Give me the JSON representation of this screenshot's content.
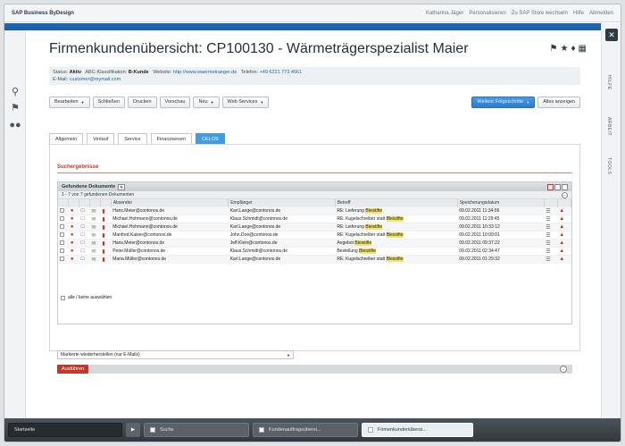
{
  "app": {
    "name": "SAP Business ByDesign",
    "topnav": [
      "Katharina Jäger",
      "Personalisieren",
      "Zu SAP Store wechseln",
      "Hilfe",
      "Abmelden"
    ]
  },
  "page": {
    "title": "Firmenkundenübersicht: CP100130 - Wärmeträgerspezialist Maier",
    "info": {
      "status_label": "Status:",
      "status_value": "Aktiv",
      "abc_label": "ABC-Klassifikation:",
      "abc_value": "B-Kunde",
      "web_label": "Website:",
      "web_value": "http://www.waermetraeger.de",
      "phone_label": "Telefon:",
      "phone_value": "+49 6221 773 4561",
      "email_label": "E-Mail:",
      "email_value": "customer@mymail.com"
    }
  },
  "toolbar": {
    "bearbeiten": "Bearbeiten",
    "schliessen": "Schließen",
    "drucken": "Drucken",
    "vorschau": "Vorschau",
    "neu": "Neu",
    "web_services": "Web Services",
    "weitere": "Weitere Folgeschritte",
    "alles_anzeigen": "Alles anzeigen"
  },
  "tabs": [
    "Allgemein",
    "Verlauf",
    "Service",
    "Finanzwesen",
    "CELOS"
  ],
  "results": {
    "section_title": "Suchergebnisse",
    "box_title": "Gefundene Dokumente",
    "count": "1 - 7 von 7 gefundenen Dokumenten",
    "columns": [
      "Absender",
      "Empfänger",
      "Betreff",
      "Speicherungsdatum"
    ],
    "rows": [
      {
        "from": "Hans.Meier@contonos.de",
        "to": "Karl.Lange@contonos.de",
        "subj": "RE: Lieferung ",
        "kw": "Bleistifte",
        "date": "09.02.2011 11:34:06"
      },
      {
        "from": "Michael.Hohmann@contonos.de",
        "to": "Klaus.Schmidt@contonos.de",
        "subj": "RE: Kugelschreiber statt ",
        "kw": "Bleistifte",
        "date": "09.02.2011 11:29:45"
      },
      {
        "from": "Michael.Hohmann@contonos.de",
        "to": "Karl.Lange@contonos.de",
        "subj": "RE: Lieferung ",
        "kw": "Bleistifte",
        "date": "09.02.2011 10:33:12"
      },
      {
        "from": "Manfred.Kaiser@contonos.de",
        "to": "John.Doe@contonos.de",
        "subj": "RE: Kugelschreiber statt ",
        "kw": "Bleistifte",
        "date": "09.02.2011 10:09:01"
      },
      {
        "from": "Hans.Meier@contonos.de",
        "to": "Jeff.Klein@contonos.de",
        "subj": "Angebot ",
        "kw": "Bleistifte",
        "date": "09.02.2011 09:37:22"
      },
      {
        "from": "Peter.Müller@contonos.de",
        "to": "Klaus.Schmidt@contonos.de",
        "subj": "Bestellung ",
        "kw": "Bleistifte",
        "date": "09.02.2011 02:34:47"
      },
      {
        "from": "Maria.Müller@contonos.de",
        "to": "Karl.Lange@contonos.de",
        "subj": "RE: Kugelschreiber statt ",
        "kw": "Bleistifte",
        "date": "09.02.2011 01:29:32"
      }
    ],
    "select_all": "alle / keine auswählen",
    "action_value": "Markierte wiederherstellen (nur E-Mails)",
    "execute": "Ausführen"
  },
  "rightnav": [
    "HILFE",
    "ARBEIT",
    "TOOLS"
  ],
  "taskbar": {
    "start": "Startseite",
    "items": [
      "Suche",
      "Kundenauftragsübersi...",
      "Firmenkundenübersi..."
    ]
  }
}
